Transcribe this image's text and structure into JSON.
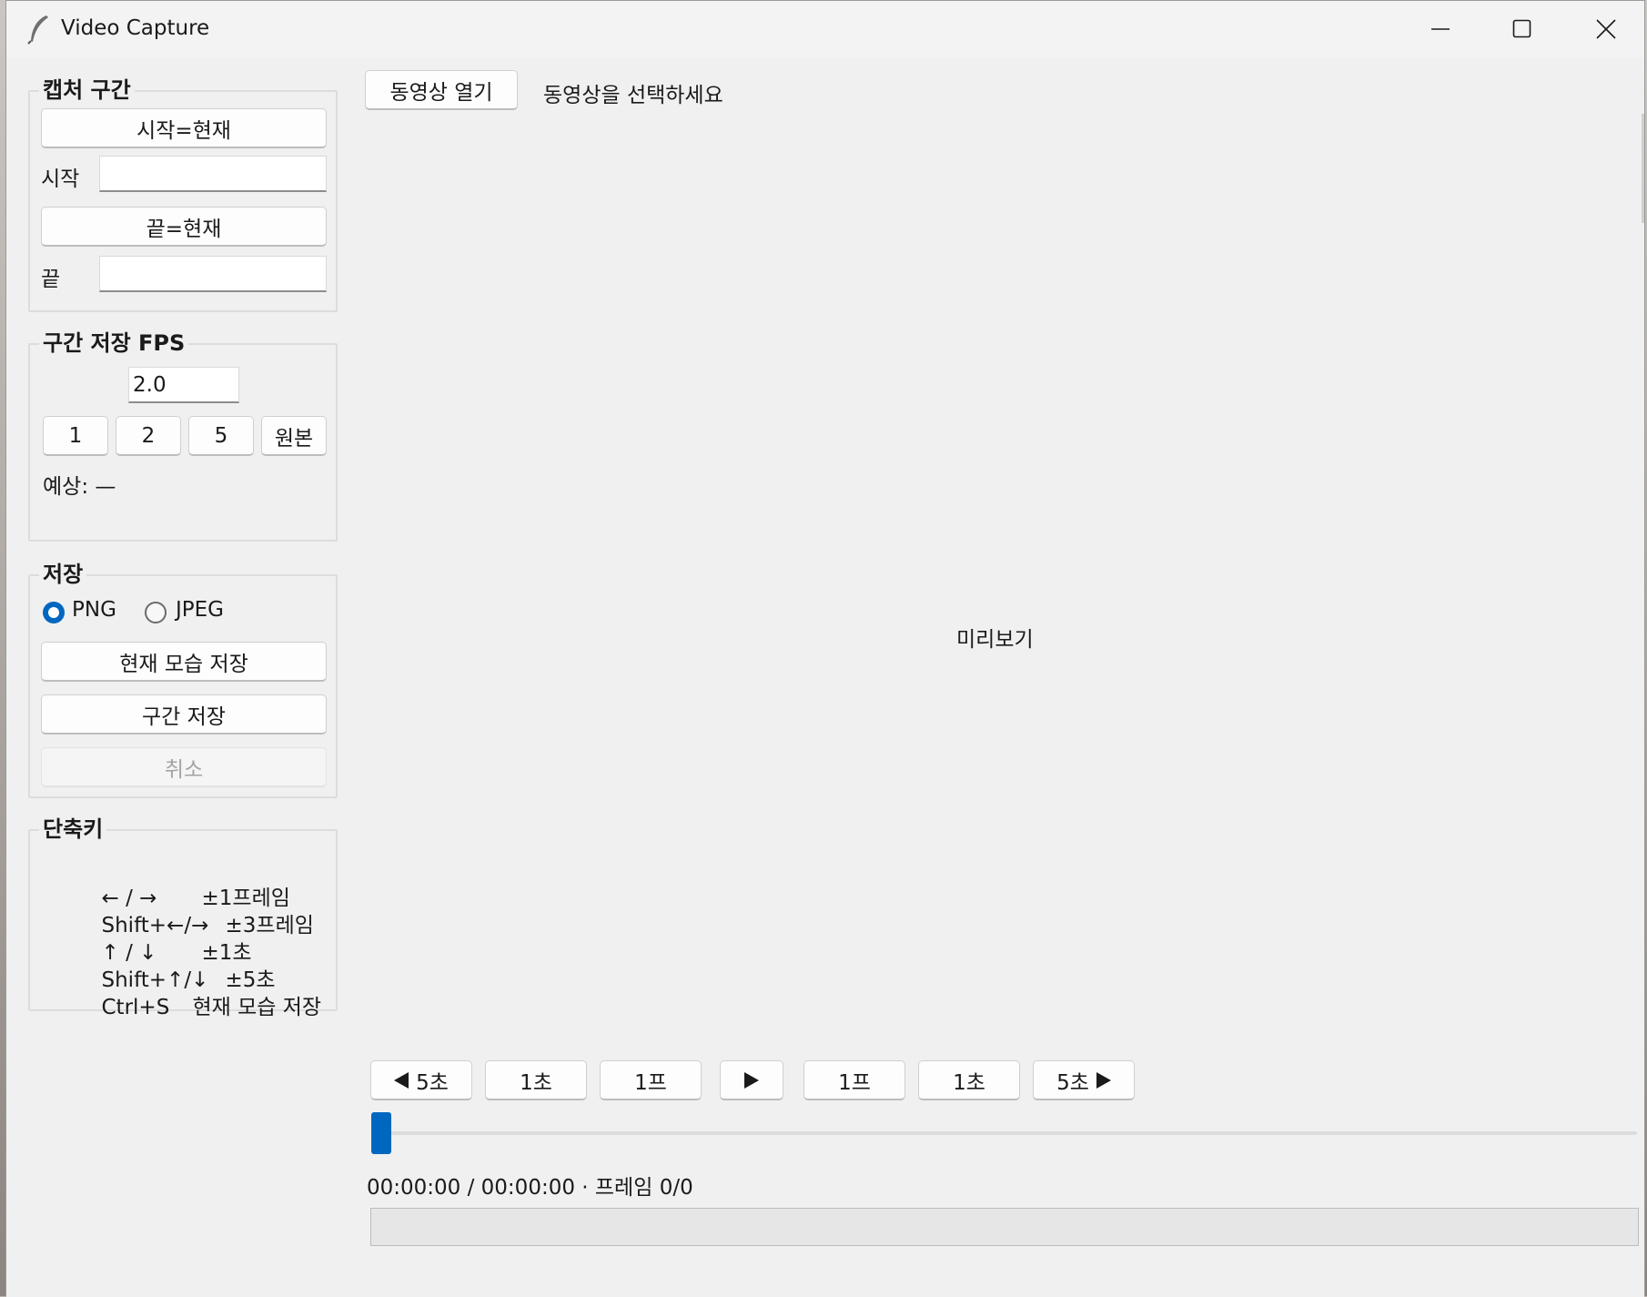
{
  "window": {
    "title": "Video Capture",
    "controls": [
      "minimize",
      "maximize",
      "close"
    ]
  },
  "capture_range": {
    "title": "캡처 구간",
    "set_start_button": "시작=현재",
    "start_label": "시작",
    "start_value": "",
    "set_end_button": "끝=현재",
    "end_label": "끝",
    "end_value": ""
  },
  "fps": {
    "title": "구간 저장 FPS",
    "value": "2.0",
    "presets": [
      "1",
      "2",
      "5",
      "원본"
    ],
    "estimate": "예상: —"
  },
  "save": {
    "title": "저장",
    "formats": [
      {
        "label": "PNG",
        "selected": true
      },
      {
        "label": "JPEG",
        "selected": false
      }
    ],
    "save_current_button": "현재 모습 저장",
    "save_range_button": "구간 저장",
    "cancel_button": "취소"
  },
  "shortcuts": {
    "title": "단축키",
    "rows": [
      {
        "key": "← / →",
        "action": "±1프레임"
      },
      {
        "key": "Shift+←/→",
        "action": "±3프레임"
      },
      {
        "key": "↑ / ↓",
        "action": "±1초"
      },
      {
        "key": "Shift+↑/↓",
        "action": "±5초"
      },
      {
        "key": "Ctrl+S",
        "action": "현재 모습 저장"
      }
    ]
  },
  "top_bar": {
    "open_button": "동영상 열기",
    "status": "동영상을 선택하세요"
  },
  "preview": {
    "placeholder": "미리보기"
  },
  "transport": {
    "back_5s": "5초",
    "back_1s": "1초",
    "back_1f": "1프",
    "play_icon": "play-icon",
    "fwd_1f": "1프",
    "fwd_1s": "1초",
    "fwd_5s": "5초"
  },
  "timeline": {
    "position_fraction": 0,
    "time_readout": "00:00:00 / 00:00:00 · 프레임 0/0"
  },
  "progress": {
    "fraction": 0
  }
}
